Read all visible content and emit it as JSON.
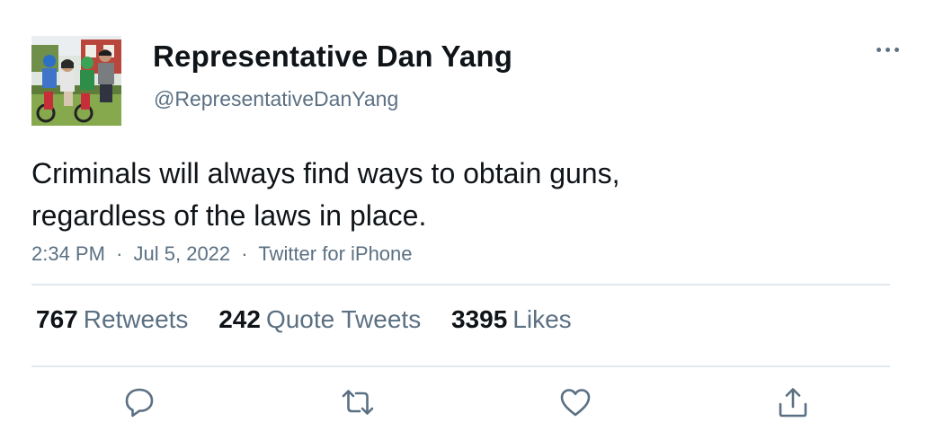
{
  "author": {
    "display_name": "Representative Dan Yang",
    "handle": "@RepresentativeDanYang",
    "avatar_icon": "family-photo-avatar"
  },
  "tweet": {
    "text_line1": "Criminals will always find ways to obtain guns,",
    "text_line2": "regardless of the laws in place.",
    "time": "2:34 PM",
    "date": "Jul 5, 2022",
    "source": "Twitter for iPhone",
    "separator": "·"
  },
  "stats": {
    "retweets_count": "767",
    "retweets_label": "Retweets",
    "quotes_count": "242",
    "quotes_label": "Quote Tweets",
    "likes_count": "3395",
    "likes_label": "Likes"
  },
  "actions": {
    "reply_icon": "reply-icon",
    "retweet_icon": "retweet-icon",
    "like_icon": "heart-icon",
    "share_icon": "share-icon",
    "more_icon": "more-options-icon"
  },
  "colors": {
    "text_primary": "#0f1419",
    "text_secondary": "#5b7083",
    "divider": "#e1e8ed",
    "background": "#ffffff"
  }
}
